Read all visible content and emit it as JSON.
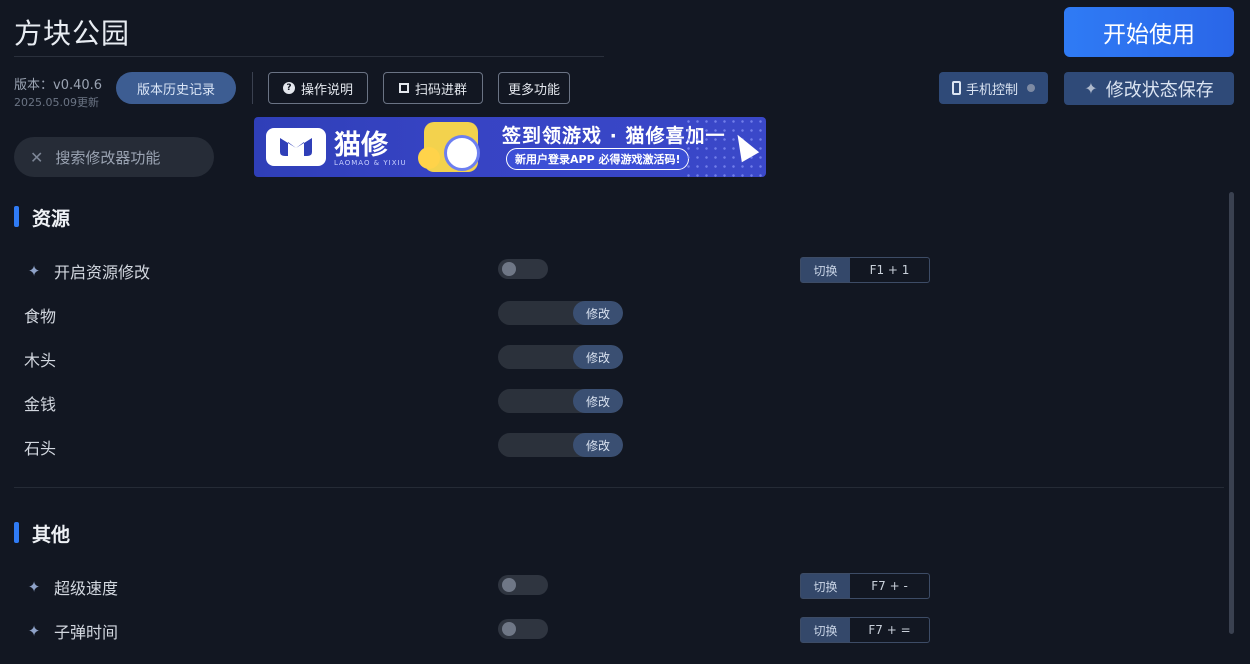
{
  "header": {
    "title": "方块公园",
    "start_label": "开始使用",
    "version": "版本：v0.40.6",
    "updated": "2025.05.09更新",
    "history_label": "版本历史记录",
    "manual_label": "操作说明",
    "scan_label": "扫码进群",
    "more_label": "更多功能",
    "phone_label": "手机控制",
    "save_label": "修改状态保存"
  },
  "search": {
    "placeholder": "搜索修改器功能"
  },
  "banner": {
    "brand": "猫修",
    "brand_sub": "LAOMAO & YIXIU",
    "headline": "签到领游戏 · 猫修喜加一",
    "subline": "新用户登录APP  必得游戏激活码!"
  },
  "sections": [
    {
      "title": "资源",
      "rows": [
        {
          "label": "开启资源修改",
          "control": "toggle",
          "on": false,
          "hotkey_action": "切换",
          "hotkey": "F1 + 1"
        },
        {
          "label": "食物",
          "control": "slider",
          "button": "修改"
        },
        {
          "label": "木头",
          "control": "slider",
          "button": "修改"
        },
        {
          "label": "金钱",
          "control": "slider",
          "button": "修改"
        },
        {
          "label": "石头",
          "control": "slider",
          "button": "修改"
        }
      ]
    },
    {
      "title": "其他",
      "rows": [
        {
          "label": "超级速度",
          "control": "toggle",
          "on": false,
          "hotkey_action": "切换",
          "hotkey": "F7 + -"
        },
        {
          "label": "子弹时间",
          "control": "toggle",
          "on": false,
          "hotkey_action": "切换",
          "hotkey": "F7 + ="
        }
      ]
    }
  ],
  "colors": {
    "accent": "#2f7bf5",
    "background": "#121722"
  }
}
